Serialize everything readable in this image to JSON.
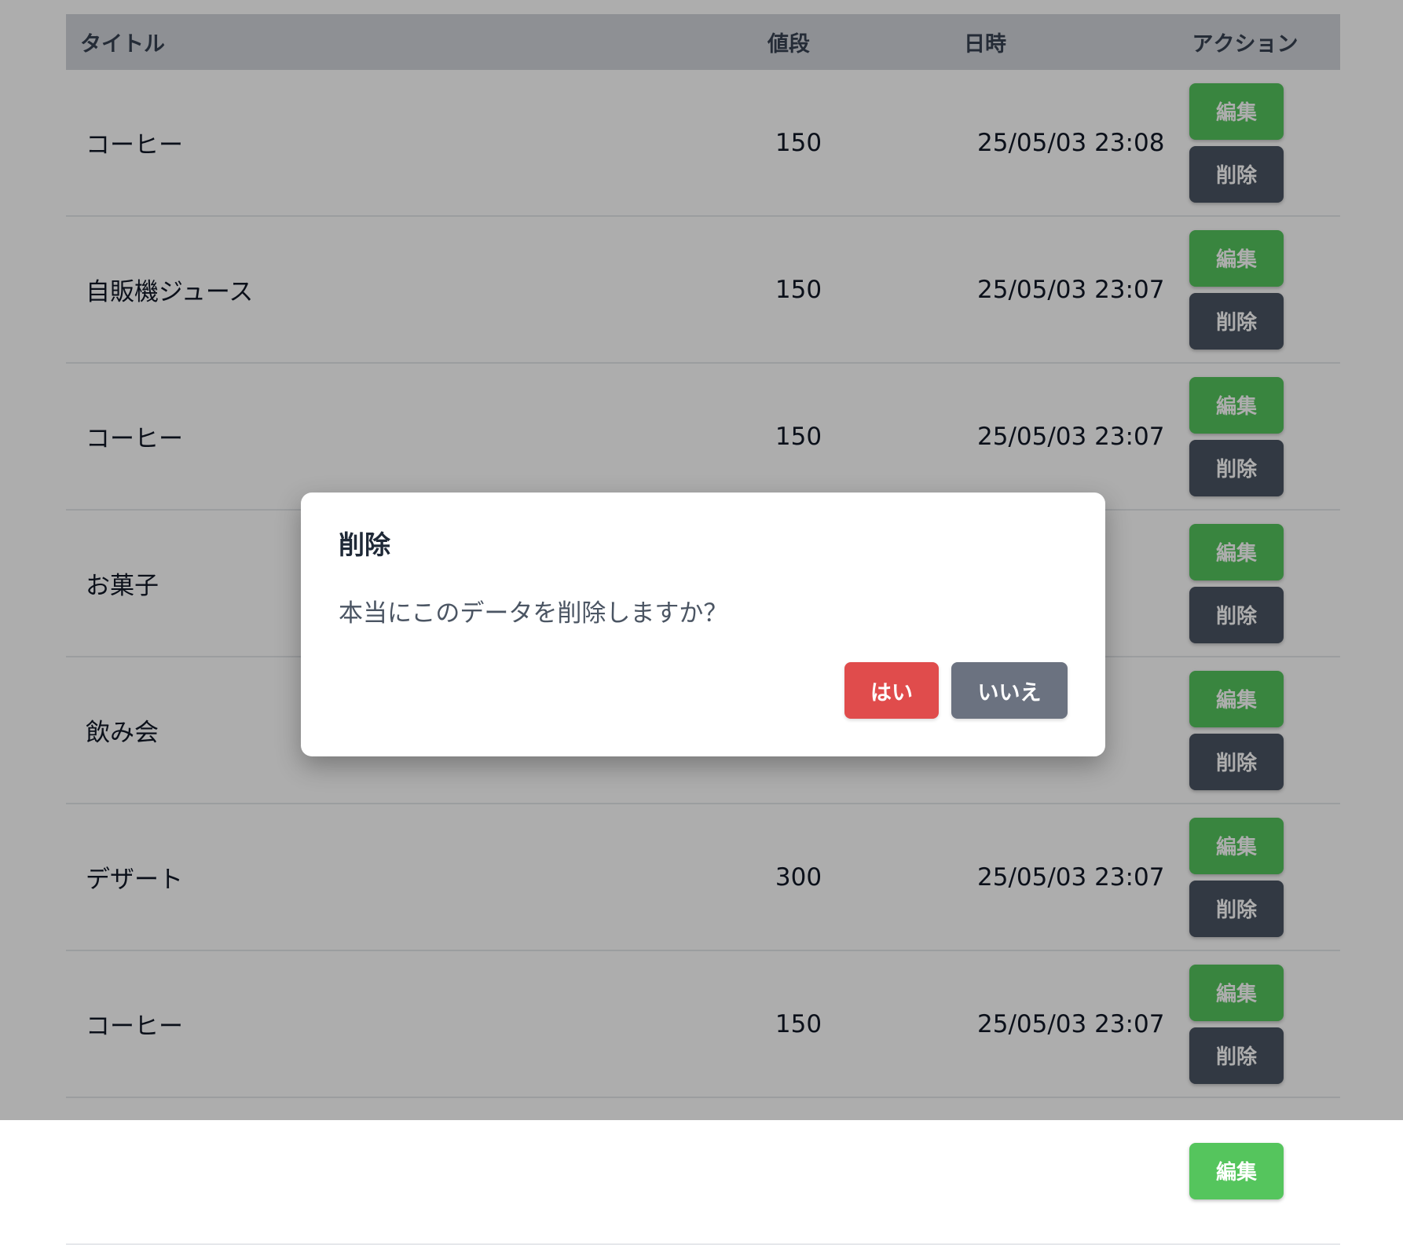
{
  "table": {
    "headers": {
      "title": "タイトル",
      "price": "値段",
      "date": "日時",
      "action": "アクション"
    },
    "rows": [
      {
        "title": "コーヒー",
        "price": "150",
        "date": "25/05/03 23:08"
      },
      {
        "title": "自販機ジュース",
        "price": "150",
        "date": "25/05/03 23:07"
      },
      {
        "title": "コーヒー",
        "price": "150",
        "date": "25/05/03 23:07"
      },
      {
        "title": "お菓子",
        "price": "",
        "date": ""
      },
      {
        "title": "飲み会",
        "price": "",
        "date": ""
      },
      {
        "title": "デザート",
        "price": "300",
        "date": "25/05/03 23:07"
      },
      {
        "title": "コーヒー",
        "price": "150",
        "date": "25/05/03 23:07"
      }
    ],
    "edit_label": "編集",
    "delete_label": "削除"
  },
  "dialog": {
    "title": "削除",
    "message": "本当にこのデータを削除しますか？",
    "confirm_label": "はい",
    "cancel_label": "いいえ"
  },
  "colors": {
    "edit_button": "#55c55d",
    "delete_button": "#4b5563",
    "confirm_button": "#e04c4c",
    "cancel_button": "#6b7280"
  }
}
